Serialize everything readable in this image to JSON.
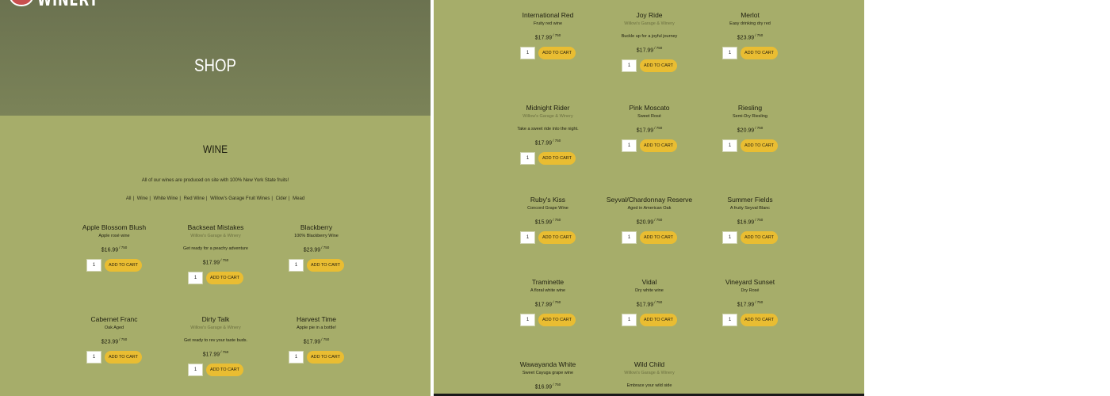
{
  "brand": {
    "logo_text": "WINERY"
  },
  "hero": {
    "title": "SHOP"
  },
  "section": {
    "title": "WINE",
    "intro": "All of our wines are produced on site with 100% New York State fruits!",
    "filters": [
      "All",
      "Wine",
      "White Wine",
      "Red Wine",
      "Willow's Garage Fruit Wines",
      "Cider",
      "Mead"
    ]
  },
  "unit": "750",
  "cart_label": "ADD TO CART",
  "default_qty": "1",
  "products": [
    {
      "name": "Apple Blossom Blush",
      "winery": "",
      "desc": "Apple rosé wine",
      "price": "$16.99"
    },
    {
      "name": "Backseat Mistakes",
      "winery": "Willow's Garage & Winery",
      "desc": "Get ready for a peachy adventure",
      "price": "$17.99"
    },
    {
      "name": "Blackberry",
      "winery": "",
      "desc": "100% Blackberry Wine",
      "price": "$23.99"
    },
    {
      "name": "Cabernet Franc",
      "winery": "",
      "desc": "Oak Aged",
      "price": "$23.99"
    },
    {
      "name": "Dirty Talk",
      "winery": "Willow's Garage & Winery",
      "desc": "Get ready to rev your taste buds.",
      "price": "$17.99"
    },
    {
      "name": "Harvest Time",
      "winery": "",
      "desc": "Apple pie in a bottle!",
      "price": "$17.99"
    },
    {
      "name": "International Red",
      "winery": "",
      "desc": "Fruity red wine",
      "price": "$17.99"
    },
    {
      "name": "Joy Ride",
      "winery": "Willow's Garage & Winery",
      "desc": "Buckle up for a joyful journey",
      "price": "$17.99"
    },
    {
      "name": "Merlot",
      "winery": "",
      "desc": "Easy drinking dry red",
      "price": "$23.99"
    },
    {
      "name": "Midnight Rider",
      "winery": "Willow's Garage & Winery",
      "desc": "Take a sweet ride into the night.",
      "price": "$17.99"
    },
    {
      "name": "Pink Moscato",
      "winery": "",
      "desc": "Sweet Rosé",
      "price": "$17.99"
    },
    {
      "name": "Riesling",
      "winery": "",
      "desc": "Semi-Dry Riesling",
      "price": "$20.99"
    },
    {
      "name": "Ruby's Kiss",
      "winery": "",
      "desc": "Concord Grape Wine",
      "price": "$15.99"
    },
    {
      "name": "Seyval/Chardonnay Reserve",
      "winery": "",
      "desc": "Aged in American Oak",
      "price": "$20.99"
    },
    {
      "name": "Summer Fields",
      "winery": "",
      "desc": "A fruity Seyval Blanc",
      "price": "$16.99"
    },
    {
      "name": "Traminette",
      "winery": "",
      "desc": "A floral white wine",
      "price": "$17.99"
    },
    {
      "name": "Vidal",
      "winery": "",
      "desc": "Dry white wine",
      "price": "$17.99"
    },
    {
      "name": "Vineyard Sunset",
      "winery": "",
      "desc": "Dry Rosé",
      "price": "$17.99"
    },
    {
      "name": "Wawayanda White",
      "winery": "",
      "desc": "Sweet Cayuga grape wine",
      "price": "$16.99"
    },
    {
      "name": "Wild Child",
      "winery": "Willow's Garage & Winery",
      "desc": "Embrace your wild side",
      "price": ""
    }
  ]
}
